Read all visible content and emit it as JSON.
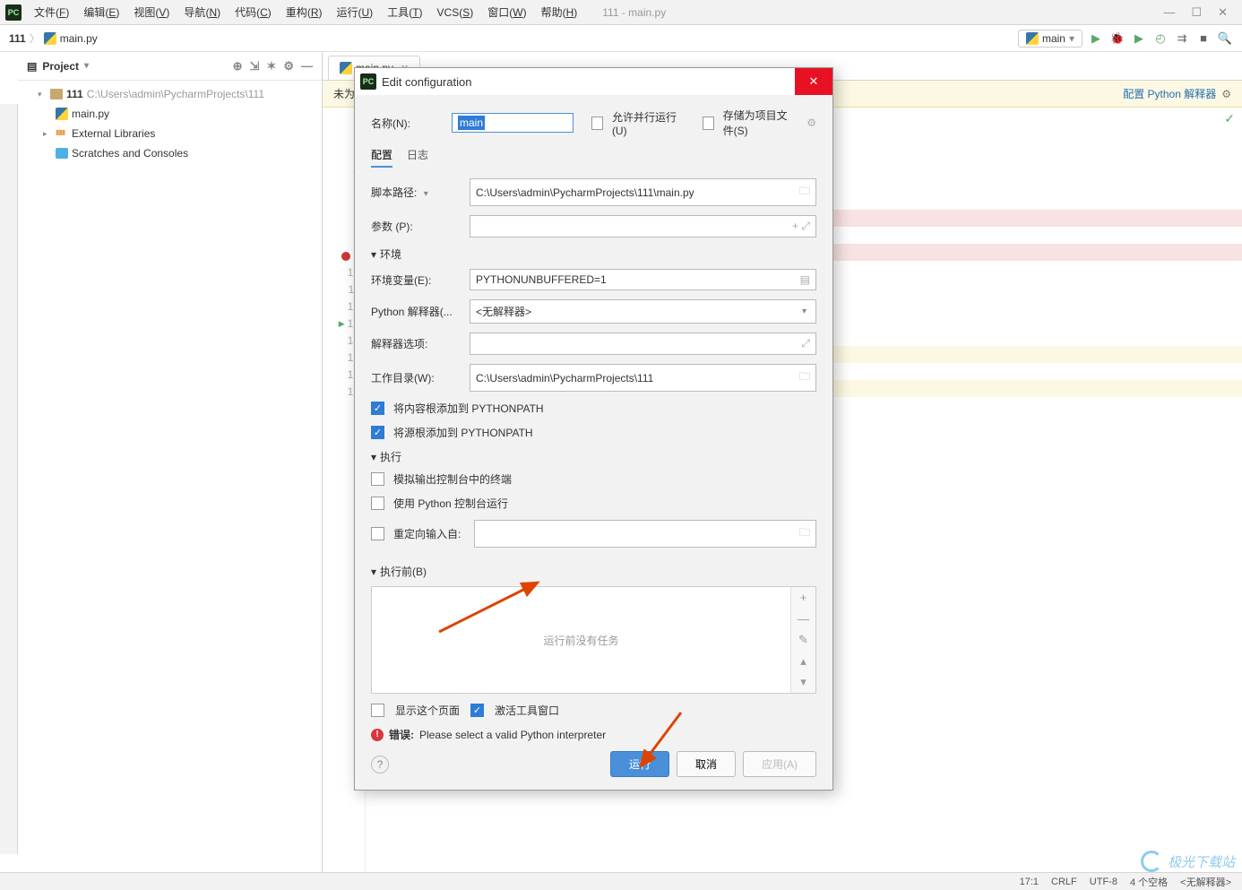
{
  "window": {
    "title": "111 - main.py"
  },
  "menu": {
    "items": [
      {
        "label": "文件",
        "key": "F"
      },
      {
        "label": "编辑",
        "key": "E"
      },
      {
        "label": "视图",
        "key": "V"
      },
      {
        "label": "导航",
        "key": "N"
      },
      {
        "label": "代码",
        "key": "C"
      },
      {
        "label": "重构",
        "key": "R"
      },
      {
        "label": "运行",
        "key": "U"
      },
      {
        "label": "工具",
        "key": "T"
      },
      {
        "label": "VCS",
        "key": "S"
      },
      {
        "label": "窗口",
        "key": "W"
      },
      {
        "label": "帮助",
        "key": "H"
      }
    ]
  },
  "breadcrumb": {
    "project": "111",
    "file": "main.py"
  },
  "runConfig": {
    "name": "main"
  },
  "projectPanel": {
    "title": "Project",
    "root": "111",
    "rootPath": "C:\\Users\\admin\\PycharmProjects\\111",
    "file": "main.py",
    "externalLibs": "External Libraries",
    "scratches": "Scratches and Consoles"
  },
  "editor": {
    "tabFile": "main.py",
    "notifyBar": {
      "prefix": "未为 pro",
      "link": "配置 Python 解释器"
    },
    "lineCount": 17,
    "breakpointLine": 9,
    "runLine": 13
  },
  "dialog": {
    "title": "Edit configuration",
    "nameLabel": "名称(N):",
    "nameValue": "main",
    "allowParallel": "允许并行运行(U)",
    "storeAsProject": "存储为项目文件(S)",
    "tabs": {
      "config": "配置",
      "logs": "日志"
    },
    "scriptLabel": "脚本路径:",
    "scriptValue": "C:\\Users\\admin\\PycharmProjects\\111\\main.py",
    "paramsLabel": "参数 (P):",
    "envSection": "环境",
    "envVarLabel": "环境变量(E):",
    "envVarValue": "PYTHONUNBUFFERED=1",
    "interpLabel": "Python 解释器(...",
    "interpValue": "<无解释器>",
    "interpOptLabel": "解释器选项:",
    "workDirLabel": "工作目录(W):",
    "workDirValue": "C:\\Users\\admin\\PycharmProjects\\111",
    "addContentRoots": "将内容根添加到 PYTHONPATH",
    "addSourceRoots": "将源根添加到 PYTHONPATH",
    "execSection": "执行",
    "emulateTerminal": "模拟输出控制台中的终端",
    "runWithConsole": "使用 Python 控制台运行",
    "redirectInput": "重定向输入自:",
    "beforeLaunch": "执行前(B)",
    "noTasks": "运行前没有任务",
    "showThisPage": "显示这个页面",
    "activateTool": "激活工具窗口",
    "errorLabel": "错误:",
    "errorText": "Please select a valid Python interpreter",
    "buttons": {
      "run": "运行",
      "cancel": "取消",
      "apply": "应用(A)"
    }
  },
  "statusbar": {
    "pos": "17:1",
    "lineEnd": "CRLF",
    "enc": "UTF-8",
    "indent": "4 个空格",
    "interp": "<无解释器>"
  },
  "watermark": "极光下载站"
}
